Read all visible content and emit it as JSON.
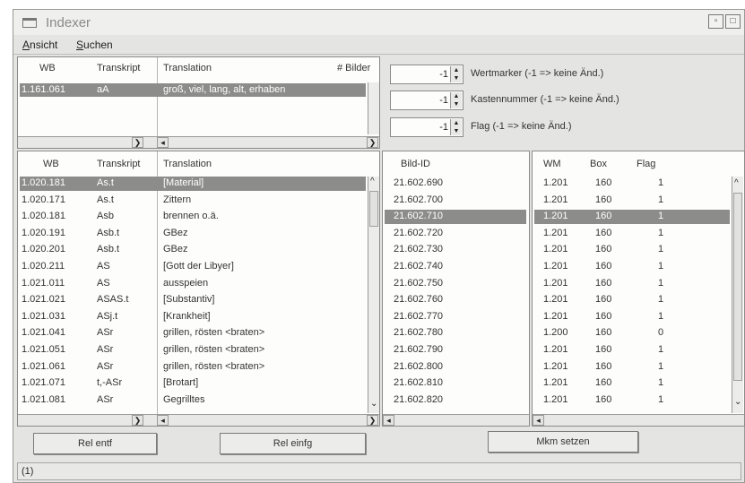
{
  "window": {
    "title": "Indexer",
    "restore_label": "▫",
    "maximize_label": "□"
  },
  "menu": [
    {
      "accel": "A",
      "rest": "nsicht"
    },
    {
      "accel": "S",
      "rest": "uchen"
    }
  ],
  "top_table": {
    "headers": [
      "WB",
      "Transkript",
      "Translation",
      "# Bilder"
    ],
    "rows": [
      [
        "1.161.061",
        "aA",
        "groß, viel, lang, alt, erhaben",
        ""
      ]
    ]
  },
  "spinners": [
    {
      "value": "-1",
      "label": "Wertmarker (-1 => keine Änd.)"
    },
    {
      "value": "-1",
      "label": "Kastennummer (-1 => keine Änd.)"
    },
    {
      "value": "-1",
      "label": "Flag (-1 => keine Änd.)"
    }
  ],
  "word_table": {
    "headers": [
      "WB",
      "Transkript",
      "Translation"
    ],
    "selected_index": 0,
    "rows": [
      [
        "1.020.181",
        "As.t",
        "[Material]"
      ],
      [
        "1.020.171",
        "As.t",
        "Zittern"
      ],
      [
        "1.020.181",
        "Asb",
        "brennen o.ä."
      ],
      [
        "1.020.191",
        "Asb.t",
        "GBez"
      ],
      [
        "1.020.201",
        "Asb.t",
        "GBez"
      ],
      [
        "1.020.211",
        "AS",
        "[Gott der Libyer]"
      ],
      [
        "1.021.011",
        "AS",
        "ausspeien"
      ],
      [
        "1.021.021",
        "ASAS.t",
        "[Substantiv]"
      ],
      [
        "1.021.031",
        "ASj.t",
        "[Krankheit]"
      ],
      [
        "1.021.041",
        "ASr",
        "grillen, rösten <braten>"
      ],
      [
        "1.021.051",
        "ASr",
        "grillen, rösten <braten>"
      ],
      [
        "1.021.061",
        "ASr",
        "grillen, rösten <braten>"
      ],
      [
        "1.021.071",
        "t,-ASr",
        "[Brotart]"
      ],
      [
        "1.021.081",
        "ASr",
        "Gegrilltes"
      ]
    ]
  },
  "image_table": {
    "headers": [
      "Bild-ID"
    ],
    "selected_index": 2,
    "rows": [
      "21.602.690",
      "21.602.700",
      "21.602.710",
      "21.602.720",
      "21.602.730",
      "21.602.740",
      "21.602.750",
      "21.602.760",
      "21.602.770",
      "21.602.780",
      "21.602.790",
      "21.602.800",
      "21.602.810",
      "21.602.820"
    ]
  },
  "mark_table": {
    "headers": [
      "WM",
      "Box",
      "Flag"
    ],
    "selected_index": 2,
    "rows": [
      [
        "1.201",
        "160",
        "1"
      ],
      [
        "1.201",
        "160",
        "1"
      ],
      [
        "1.201",
        "160",
        "1"
      ],
      [
        "1.201",
        "160",
        "1"
      ],
      [
        "1.201",
        "160",
        "1"
      ],
      [
        "1.201",
        "160",
        "1"
      ],
      [
        "1.201",
        "160",
        "1"
      ],
      [
        "1.201",
        "160",
        "1"
      ],
      [
        "1.201",
        "160",
        "1"
      ],
      [
        "1.200",
        "160",
        "0"
      ],
      [
        "1.201",
        "160",
        "1"
      ],
      [
        "1.201",
        "160",
        "1"
      ],
      [
        "1.201",
        "160",
        "1"
      ],
      [
        "1.201",
        "160",
        "1"
      ]
    ]
  },
  "buttons": {
    "rel_entf": "Rel entf",
    "rel_einfg": "Rel einfg",
    "mkm_setzen": "Mkm setzen"
  },
  "status": {
    "text": "(1)"
  },
  "icons": {
    "scroll_left": "◂",
    "scroll_right": "❯",
    "scroll_up": "^",
    "scroll_down": "⌄",
    "spin_up": "▲",
    "spin_down": "▼"
  }
}
